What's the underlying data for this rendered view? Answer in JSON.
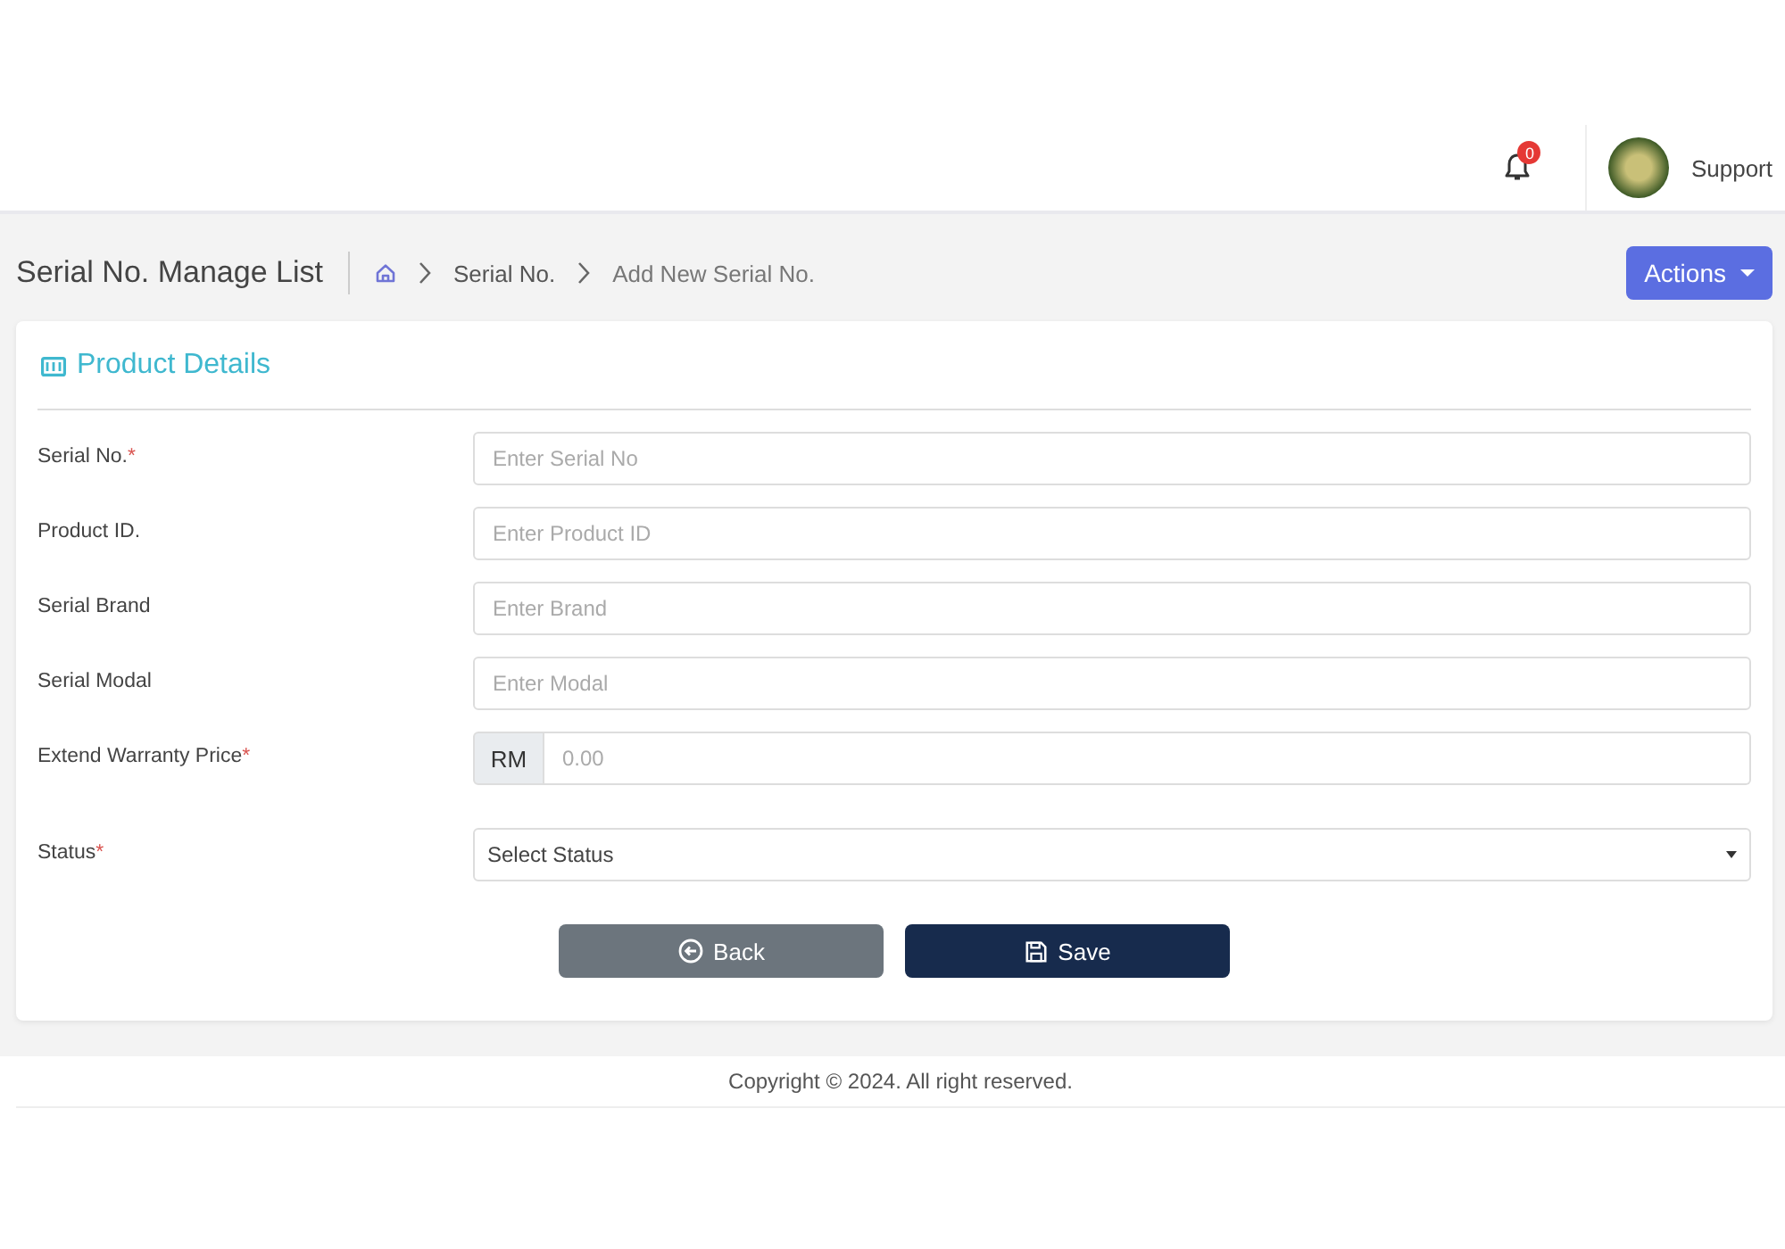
{
  "header": {
    "notification_count": "0",
    "user_name": "Support"
  },
  "page_header": {
    "title": "Serial No. Manage List",
    "breadcrumb": [
      "Serial No.",
      "Add New Serial No."
    ],
    "actions_button": "Actions"
  },
  "card": {
    "title": "Product Details",
    "fields": [
      {
        "kind": "text",
        "label": "Serial No.",
        "required_mark": "*",
        "placeholder": "Enter Serial No"
      },
      {
        "kind": "text",
        "label": "Product ID.",
        "placeholder": "Enter Product ID"
      },
      {
        "kind": "text",
        "label": "Serial Brand",
        "placeholder": "Enter Brand"
      },
      {
        "kind": "text",
        "label": "Serial Modal",
        "placeholder": "Enter Modal"
      },
      {
        "kind": "prefixed",
        "label": "Extend Warranty Price",
        "required_mark": "*",
        "prefix": "RM",
        "placeholder": "0.00"
      },
      {
        "kind": "select",
        "label": "Status",
        "required_mark": "*",
        "value": "Select Status"
      }
    ],
    "buttons": [
      {
        "kind": "back",
        "label": "Back"
      },
      {
        "kind": "save",
        "label": "Save"
      }
    ]
  },
  "footer": {
    "text": "Copyright © 2024. All right reserved."
  }
}
